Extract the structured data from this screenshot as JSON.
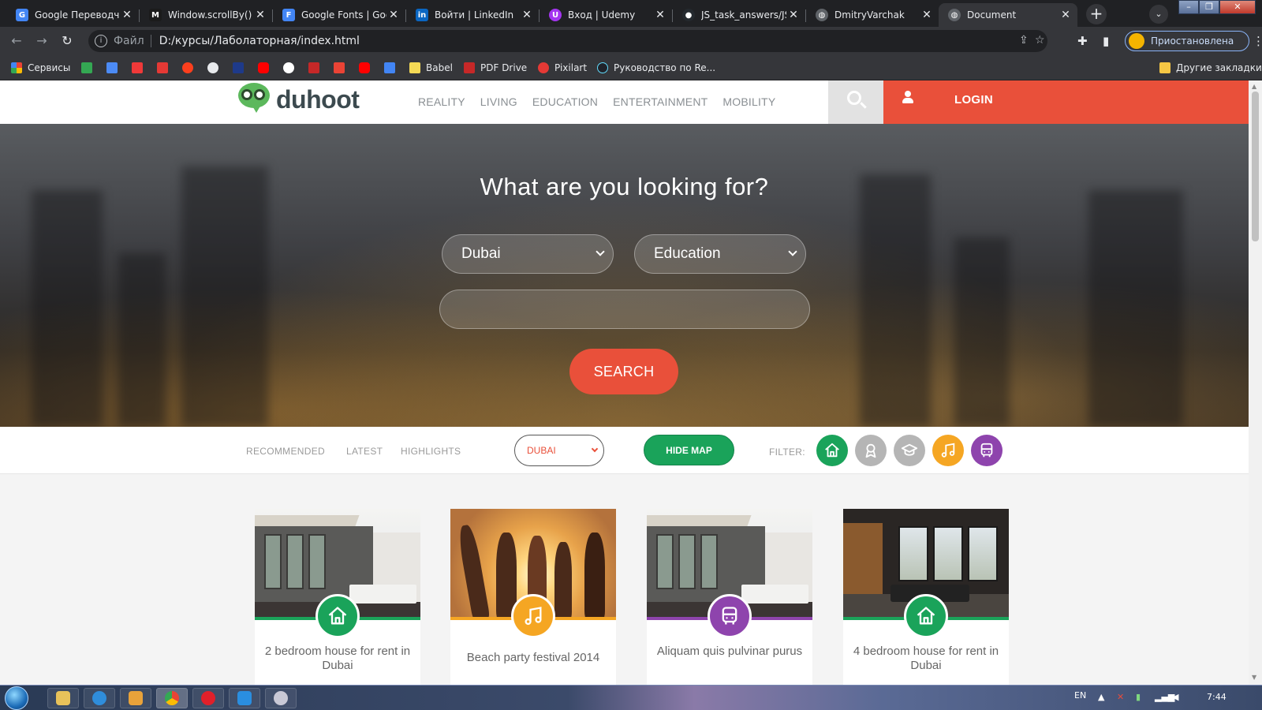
{
  "browser": {
    "tabs": [
      {
        "title": "Google Переводчик",
        "favicon": "google-translate-icon",
        "color": "#4285f4",
        "glyph": "G"
      },
      {
        "title": "Window.scrollBy() - ",
        "favicon": "mdn-icon",
        "color": "#1b1b1b",
        "glyph": "M"
      },
      {
        "title": "Google Fonts | Goo",
        "favicon": "google-fonts-icon",
        "color": "#4285f4",
        "glyph": "F"
      },
      {
        "title": "Войти | LinkedIn",
        "favicon": "linkedin-icon",
        "color": "#0a66c2",
        "glyph": "in"
      },
      {
        "title": "Вход | Udemy",
        "favicon": "udemy-icon",
        "color": "#a435f0",
        "glyph": "U"
      },
      {
        "title": "JS_task_answers/JS_",
        "favicon": "github-icon",
        "color": "#24292e",
        "glyph": "●"
      },
      {
        "title": "DmitryVarchak",
        "favicon": "globe-icon",
        "color": "#5f6368",
        "glyph": "◍"
      },
      {
        "title": "Document",
        "favicon": "globe-icon",
        "color": "#5f6368",
        "glyph": "◍"
      }
    ],
    "new_tab": "+",
    "tab_search": "⌄",
    "address": {
      "scheme": "Файл",
      "url": "D:/курсы/Лаболаторная/index.html"
    },
    "profile_label": "Приостановлена",
    "bookmarks": [
      {
        "label": "Сервисы",
        "color": "#ea4335"
      },
      {
        "label": "",
        "color": "#34a853"
      },
      {
        "label": "",
        "color": "#4c8bf5"
      },
      {
        "label": "",
        "color": "#ef3939"
      },
      {
        "label": "",
        "color": "#e53935"
      },
      {
        "label": "",
        "color": "#fc3f1d"
      },
      {
        "label": "",
        "color": "#ffffff"
      },
      {
        "label": "",
        "color": "#1e3a8a"
      },
      {
        "label": "",
        "color": "#ff0000"
      },
      {
        "label": "",
        "color": "#ffffff"
      },
      {
        "label": "",
        "color": "#c62828"
      },
      {
        "label": "",
        "color": "#ea4335"
      },
      {
        "label": "",
        "color": "#ff0000"
      },
      {
        "label": "",
        "color": "#4285f4"
      },
      {
        "label": "Babel",
        "color": "#f5da55"
      },
      {
        "label": "PDF Drive",
        "color": "#c62828"
      },
      {
        "label": "Pixilart",
        "color": "#e53935"
      },
      {
        "label": "Руководство по Re...",
        "color": "#61dafb"
      }
    ],
    "other_bookmarks": "Другие закладки"
  },
  "site": {
    "logo_text": "duhoot",
    "nav": [
      "REALITY",
      "LIVING",
      "EDUCATION",
      "ENTERTAINMENT",
      "MOBILITY"
    ],
    "login_label": "LOGIN",
    "hero": {
      "title": "What are you looking for?",
      "city_value": "Dubai",
      "category_value": "Education",
      "search_value": "",
      "search_button": "SEARCH"
    },
    "filterbar": {
      "links": [
        "RECOMMENDED",
        "LATEST",
        "HIGHLIGHTS"
      ],
      "city_value": "DUBAI",
      "hide_map": "HIDE MAP",
      "filter_label": "FILTER:",
      "icons": [
        {
          "name": "home-icon",
          "color": "#1aa35a"
        },
        {
          "name": "award-icon",
          "color": "#b5b5b5"
        },
        {
          "name": "graduation-cap-icon",
          "color": "#b5b5b5"
        },
        {
          "name": "music-note-icon",
          "color": "#f5a623"
        },
        {
          "name": "bus-icon",
          "color": "#8e44ad"
        }
      ]
    },
    "cards": [
      {
        "title": "2 bedroom house for rent in Dubai",
        "icon": "home-icon",
        "color": "#1aa35a"
      },
      {
        "title": "Beach party festival 2014",
        "icon": "music-note-icon",
        "color": "#f5a623"
      },
      {
        "title": "Aliquam quis pulvinar purus",
        "icon": "bus-icon",
        "color": "#8e44ad"
      },
      {
        "title": "4 bedroom house for rent in Dubai",
        "icon": "home-icon",
        "color": "#1aa35a"
      }
    ]
  },
  "taskbar": {
    "lang": "EN",
    "time": "7:44"
  }
}
